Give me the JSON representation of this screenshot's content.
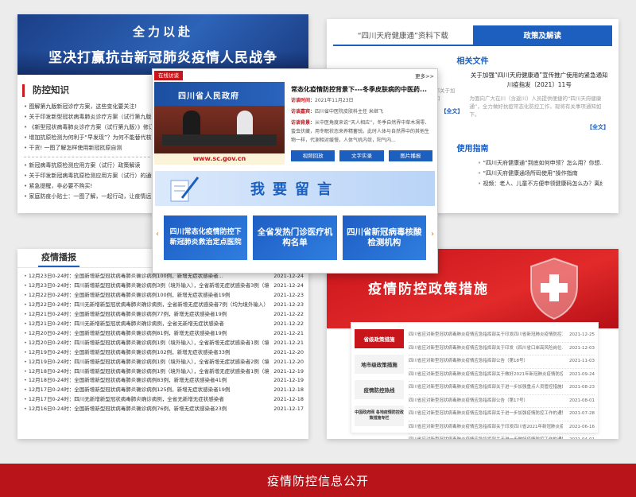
{
  "prevention": {
    "banner_line1": "全力以赴",
    "banner_line2": "坚决打赢抗击新冠肺炎疫情人民战争",
    "title": "防控知识",
    "items_a": [
      "图解第九版新冠诊疗方案，这些变化要关注!",
      "关于印发新型冠状病毒肺炎诊疗方案（试行第九版）的通知",
      "《新型冠状病毒肺炎诊疗方案（试行第九版）》修订要点",
      "增加抗原检测为何利于“早发现”？为何不能替代核酸检测",
      "干货! 一图了解怎样使用新冠抗原自测"
    ],
    "items_b": [
      "新冠病毒抗原检测应用方案（试行）政策解读",
      "关于印发新冠病毒抗原检测应用方案（试行）的通知",
      "紧急提醒，非必要不购买!",
      "家庭防疫小贴士：一图了解，一起行动，让疫情远离我们"
    ]
  },
  "files": {
    "tab_download": "“四川天府健康通”资料下载",
    "tab_policy": "政策及解读",
    "section_related": "相关文件",
    "doc1_title": "四川省应对新型冠状病毒肺炎疫情应急指挥部关于加强“四川天府健康通”宣传推广使用的紧急通知",
    "doc1_snippet": "四川省应对新型冠状病毒肺炎疫情应急指挥部关于加强“四川天府健康通”宣传推广使用的紧急通知",
    "doc2_title": "关于加强“四川天府健康通”宣传推广使用的紧急通知 川疫指发〔2021〕11号",
    "doc2_snippet": "为面向广大在川（含返川）人员提供便捷的“四川天府健康通”，全力做好抗疫常态化防控工作，现将有关事项通知如下。",
    "full_text": "【全文】",
    "section_guide": "使用指南",
    "guides": [
      "“四川天府健康通”到底如何申领？怎么用？你想...",
      "“四川天府健康通场所码使用”操作指南",
      "视频：老人、儿童不方便申领健康码怎么办？离线..."
    ]
  },
  "broadcast": {
    "title": "疫情播报",
    "rows": [
      {
        "text": "12月23日0-24时：全国新增新型冠状病毒肺炎确诊病例100例，新增无症状感染者...",
        "date": "2021-12-24"
      },
      {
        "text": "12月23日0-24时：四川新增新型冠状病毒肺炎确诊病例3例（境外输入），全省新增无症状感染者3例（境外...",
        "date": "2021-12-24"
      },
      {
        "text": "12月22日0-24时：全国新增新型冠状病毒肺炎确诊病例100例，新增无症状感染者19例",
        "date": "2021-12-23"
      },
      {
        "text": "12月22日0-24时：四川无新增新型冠状病毒肺炎确诊病例，全省新增无症状感染者7例（均为境外输入）",
        "date": "2021-12-23"
      },
      {
        "text": "12月21日0-24时：全国新增新型冠状病毒肺炎确诊病例77例，新增无症状感染者19例",
        "date": "2021-12-22"
      },
      {
        "text": "12月21日0-24时：四川无新增新型冠状病毒肺炎确诊病例，全省无新增无症状感染者",
        "date": "2021-12-22"
      },
      {
        "text": "12月20日0-24时：全国新增新型冠状病毒肺炎确诊病例81例，新增无症状感染者19例",
        "date": "2021-12-21"
      },
      {
        "text": "12月20日0-24时：四川新增新型冠状病毒肺炎确诊病例1例（境外输入），全省新增无症状感染者1例（境外...",
        "date": "2021-12-21"
      },
      {
        "text": "12月19日0-24时：全国新增新型冠状病毒肺炎确诊病例102例，新增无症状感染者33例",
        "date": "2021-12-20"
      },
      {
        "text": "12月19日0-24时：四川新增新型冠状病毒肺炎确诊病例1例（境外输入），全省新增无症状感染者2例（境外...",
        "date": "2021-12-20"
      },
      {
        "text": "12月18日0-24时：四川新增新型冠状病毒肺炎确诊病例1例（境外输入），全省新增无症状感染者1例（境外...",
        "date": "2021-12-19"
      },
      {
        "text": "12月18日0-24时：全国新增新型冠状病毒肺炎确诊病例83例，新增无症状感染者41例",
        "date": "2021-12-19"
      },
      {
        "text": "12月17日0-24时：全国新增新型冠状病毒肺炎确诊病例125例，新增无症状感染者19例",
        "date": "2021-12-18"
      },
      {
        "text": "12月17日0-24时：四川无新增新型冠状病毒肺炎确诊病例，全省无新增无症状感染者",
        "date": "2021-12-18"
      },
      {
        "text": "12月16日0-24时：全国新增新型冠状病毒肺炎确诊病例76例，新增无症状感染者23例",
        "date": "2021-12-17"
      }
    ]
  },
  "measures": {
    "title": "疫情防控政策措施",
    "menu": [
      "省级政策措施",
      "地市级政策措施",
      "疫情防控热线",
      "中国政府网 各地疫情防控政策措施专栏"
    ],
    "rows": [
      {
        "text": "四川省应对新型冠状病毒肺炎疫情应急指挥部关于印发四川省新冠肺炎疫情防控工作方案的通知",
        "date": "2021-12-25"
      },
      {
        "text": "四川省应对新型冠状病毒肺炎疫情应急指挥部关于印发《四川省口岸高风险岗位...》的通知",
        "date": "2021-12-03"
      },
      {
        "text": "四川省应对新型冠状病毒肺炎疫情应急指挥部公告（第18号）",
        "date": "2021-11-03"
      },
      {
        "text": "四川省应对新型冠状病毒肺炎疫情应急指挥部关于做好2021年新冠肺炎疫情防控的通知",
        "date": "2021-09-24"
      },
      {
        "text": "四川省应对新型冠状病毒肺炎疫情应急指挥部关于进一步加强重点人员管控措施的通知",
        "date": "2021-08-23"
      },
      {
        "text": "四川省应对新型冠状病毒肺炎疫情应急指挥部公告（第17号）",
        "date": "2021-08-01"
      },
      {
        "text": "四川省应对新型冠状病毒肺炎疫情应急指挥部关于进一步加强疫情防控工作的通知",
        "date": "2021-07-28"
      },
      {
        "text": "四川省应对新型冠状病毒肺炎疫情应急指挥部关于印发四川省2021年新冠肺炎疫苗接种...",
        "date": "2021-06-16"
      },
      {
        "text": "四川省应对新型冠状病毒肺炎疫情应急指挥部关于进一步做好疫情防控工作的通知",
        "date": "2021-04-01"
      }
    ]
  },
  "interview": {
    "tag": "在线访谈",
    "more": "更多>>",
    "img_header": "四川省人民政府",
    "img_url": "www.sc.gov.cn",
    "headline": "常态化疫情防控背景下---冬季皮肤病的中医药...",
    "time_label": "访谈时间：",
    "time_value": "2021年11月23日",
    "guest_label": "访谈嘉宾：",
    "guest_value": "四川省中医院皮肤科主任 米继飞",
    "bg_label": "访谈背景：",
    "bg_value": "从中医角度来说“天人相应”，冬季自然界中草木凋零、蛰虫伏藏，用冬眠状态来养精蓄锐。此时人体与自然界中的其他生物一样，代谢相对缓慢，人体气机内敛，阳气内...",
    "buttons": [
      "视频回放",
      "文字实录",
      "图片播报"
    ],
    "banner": "我要留言",
    "cards": [
      "四川常态化疫情防控下新冠肺炎救治定点医院",
      "全省发热门诊医疗机构名单",
      "四川省新冠病毒核酸检测机构"
    ],
    "arrow_left": "‹",
    "arrow_right": "›"
  },
  "footer": "疫情防控信息公开"
}
